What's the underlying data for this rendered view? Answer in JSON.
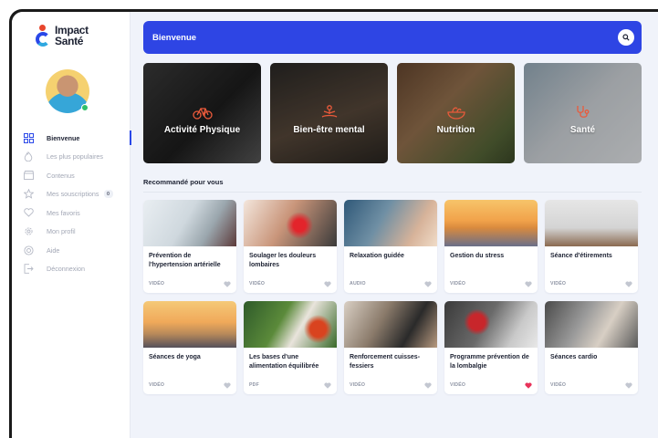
{
  "app": {
    "logo_line1": "Impact",
    "logo_line2": "Santé"
  },
  "sidebar": {
    "items": [
      {
        "label": "Bienvenue",
        "icon": "grid-icon",
        "active": true
      },
      {
        "label": "Les plus populaires",
        "icon": "flame-icon"
      },
      {
        "label": "Contenus",
        "icon": "clapper-icon"
      },
      {
        "label": "Mes souscriptions",
        "icon": "star-icon",
        "badge": "0"
      },
      {
        "label": "Mes favoris",
        "icon": "heart-icon"
      },
      {
        "label": "Mon profil",
        "icon": "gear-icon"
      },
      {
        "label": "Aide",
        "icon": "lifebuoy-icon"
      },
      {
        "label": "Déconnexion",
        "icon": "logout-icon"
      }
    ]
  },
  "header": {
    "title": "Bienvenue",
    "search_icon": "search-icon"
  },
  "categories": [
    {
      "label": "Activité Physique",
      "icon": "bike-icon"
    },
    {
      "label": "Bien-être mental",
      "icon": "meditation-icon"
    },
    {
      "label": "Nutrition",
      "icon": "salad-icon"
    },
    {
      "label": "Santé",
      "icon": "stethoscope-icon"
    }
  ],
  "recommended": {
    "title": "Recommandé pour vous",
    "cards": [
      {
        "title": "Prévention de l'hypertension artérielle",
        "type": "VIDÉO",
        "favorite": false
      },
      {
        "title": "Soulager les douleurs lombaires",
        "type": "VIDÉO",
        "favorite": false
      },
      {
        "title": "Relaxation guidée",
        "type": "AUDIO",
        "favorite": false
      },
      {
        "title": "Gestion du stress",
        "type": "VIDÉO",
        "favorite": false
      },
      {
        "title": "Séance d'étirements",
        "type": "VIDÉO",
        "favorite": false
      },
      {
        "title": "Séances de yoga",
        "type": "VIDÉO",
        "favorite": false
      },
      {
        "title": "Les bases d'une alimentation équilibrée",
        "type": "PDF",
        "favorite": false
      },
      {
        "title": "Renforcement cuisses-fessiers",
        "type": "VIDÉO",
        "favorite": false
      },
      {
        "title": "Programme prévention de la lombalgie",
        "type": "VIDÉO",
        "favorite": true
      },
      {
        "title": "Séances cardio",
        "type": "VIDÉO",
        "favorite": false
      }
    ]
  },
  "colors": {
    "accent": "#2e45e4",
    "favorite": "#e8335a",
    "heart_default": "#c3c7d1",
    "icon_accent": "#ea5a3b"
  }
}
